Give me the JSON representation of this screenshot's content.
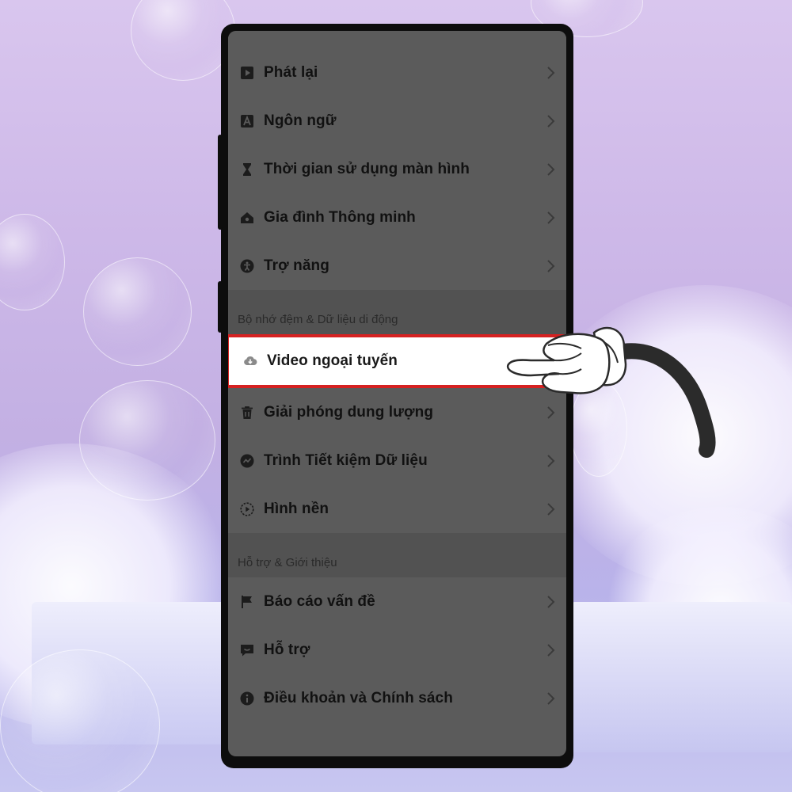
{
  "settings": {
    "rows_top": [
      {
        "label": "Phát lại",
        "icon": "play-square-icon"
      },
      {
        "label": "Ngôn ngữ",
        "icon": "language-a-icon"
      },
      {
        "label": "Thời gian sử dụng màn hình",
        "icon": "hourglass-icon"
      },
      {
        "label": "Gia đình Thông minh",
        "icon": "home-icon"
      },
      {
        "label": "Trợ năng",
        "icon": "accessibility-icon"
      }
    ],
    "section_cache": "Bộ nhớ đệm & Dữ liệu di động",
    "rows_cache": [
      {
        "label": "Video ngoại tuyến",
        "icon": "cloud-download-icon",
        "highlighted": true
      },
      {
        "label": "Giải phóng dung lượng",
        "icon": "trash-icon"
      },
      {
        "label": "Trình Tiết kiệm Dữ liệu",
        "icon": "data-saver-icon"
      },
      {
        "label": "Hình nền",
        "icon": "wallpaper-play-icon"
      }
    ],
    "section_support": "Hỗ trợ & Giới thiệu",
    "rows_support": [
      {
        "label": "Báo cáo vấn đề",
        "icon": "flag-icon"
      },
      {
        "label": "Hỗ trợ",
        "icon": "chat-support-icon"
      },
      {
        "label": "Điều khoản và Chính sách",
        "icon": "info-icon"
      }
    ]
  },
  "colors": {
    "overlay": "#5b5b5b",
    "highlight_border": "#d52121",
    "highlight_bg": "#ffffff"
  }
}
